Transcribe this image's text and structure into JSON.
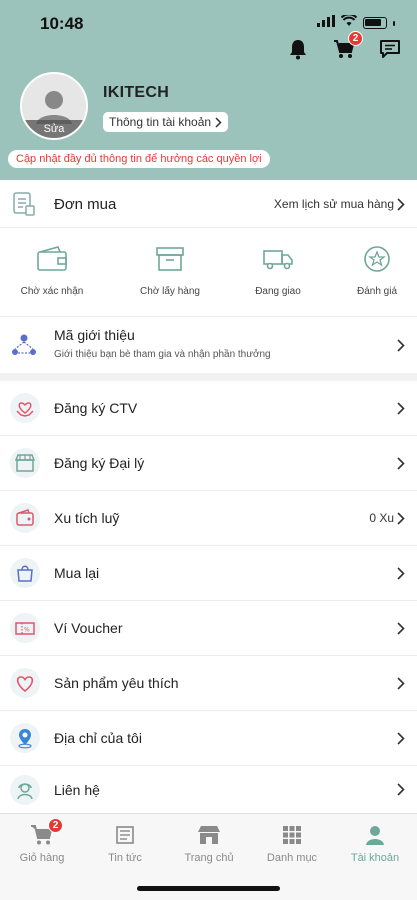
{
  "status_bar": {
    "time": "10:48"
  },
  "header": {
    "cart_badge": "2",
    "username": "IKITECH",
    "avatar_edit_label": "Sửa",
    "account_info_label": "Thông tin tài khoản",
    "update_notice": "Cập nhật đầy đủ thông tin để hưởng các quyền lợi"
  },
  "orders": {
    "title": "Đơn mua",
    "history_link": "Xem lịch sử mua hàng",
    "statuses": [
      {
        "label": "Chờ xác nhận",
        "icon": "wallet-icon"
      },
      {
        "label": "Chờ lấy hàng",
        "icon": "box-icon"
      },
      {
        "label": "Đang giao",
        "icon": "truck-icon"
      },
      {
        "label": "Đánh giá",
        "icon": "star-icon"
      }
    ]
  },
  "referral": {
    "title": "Mã giới thiệu",
    "subtitle": "Giới thiệu bạn bè tham gia và nhận phần thưởng"
  },
  "menu": [
    {
      "label": "Đăng ký CTV",
      "icon": "heart-hands-icon",
      "value": ""
    },
    {
      "label": "Đăng ký Đại lý",
      "icon": "store-icon",
      "value": ""
    },
    {
      "label": "Xu tích luỹ",
      "icon": "coin-wallet-icon",
      "value": "0 Xu"
    },
    {
      "label": "Mua lại",
      "icon": "bag-icon",
      "value": ""
    },
    {
      "label": "Ví Voucher",
      "icon": "voucher-icon",
      "value": ""
    },
    {
      "label": "Sản phẩm yêu thích",
      "icon": "heart-icon",
      "value": ""
    },
    {
      "label": "Địa chỉ của tôi",
      "icon": "location-pin-icon",
      "value": ""
    },
    {
      "label": "Liên hệ",
      "icon": "support-agent-icon",
      "value": ""
    }
  ],
  "bottom_nav": [
    {
      "label": "Giỏ hàng",
      "icon": "cart-icon",
      "badge": "2"
    },
    {
      "label": "Tin tức",
      "icon": "news-icon"
    },
    {
      "label": "Trang chủ",
      "icon": "shop-icon"
    },
    {
      "label": "Danh mục",
      "icon": "grid-icon"
    },
    {
      "label": "Tài khoản",
      "icon": "user-icon",
      "active": true
    }
  ],
  "colors": {
    "header_bg": "#9cc3bb",
    "accent": "#6fa79a",
    "alert": "#e53935"
  }
}
